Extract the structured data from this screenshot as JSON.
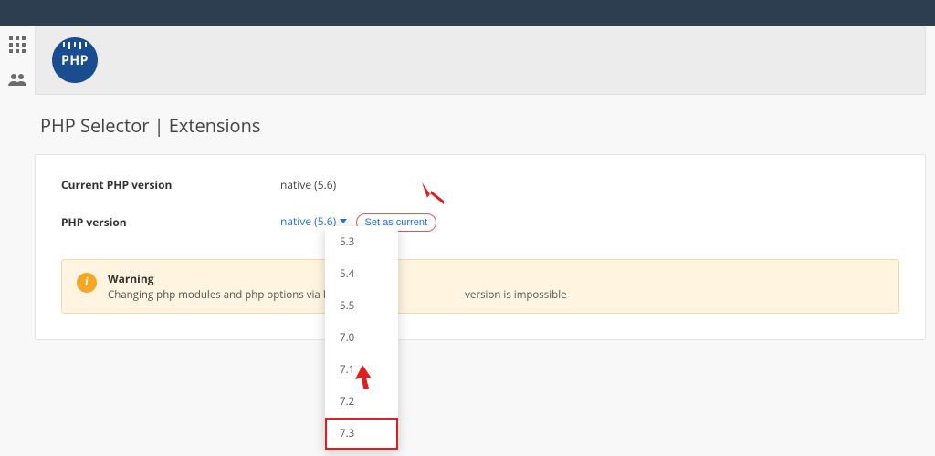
{
  "logo": {
    "text": "PHP"
  },
  "page": {
    "title": "PHP Selector | Extensions"
  },
  "fields": {
    "current_label": "Current PHP version",
    "current_value": "native (5.6)",
    "version_label": "PHP version",
    "dropdown_selected": "native (5.6)"
  },
  "buttons": {
    "set_current": "Set as current"
  },
  "dropdown": {
    "options": [
      "5.3",
      "5.4",
      "5.5",
      "7.0",
      "7.1",
      "7.2",
      "7.3"
    ],
    "highlighted": "7.3"
  },
  "alert": {
    "title": "Warning",
    "body_prefix": "Changing php modules and php options via PH",
    "body_suffix": "version is impossible"
  }
}
